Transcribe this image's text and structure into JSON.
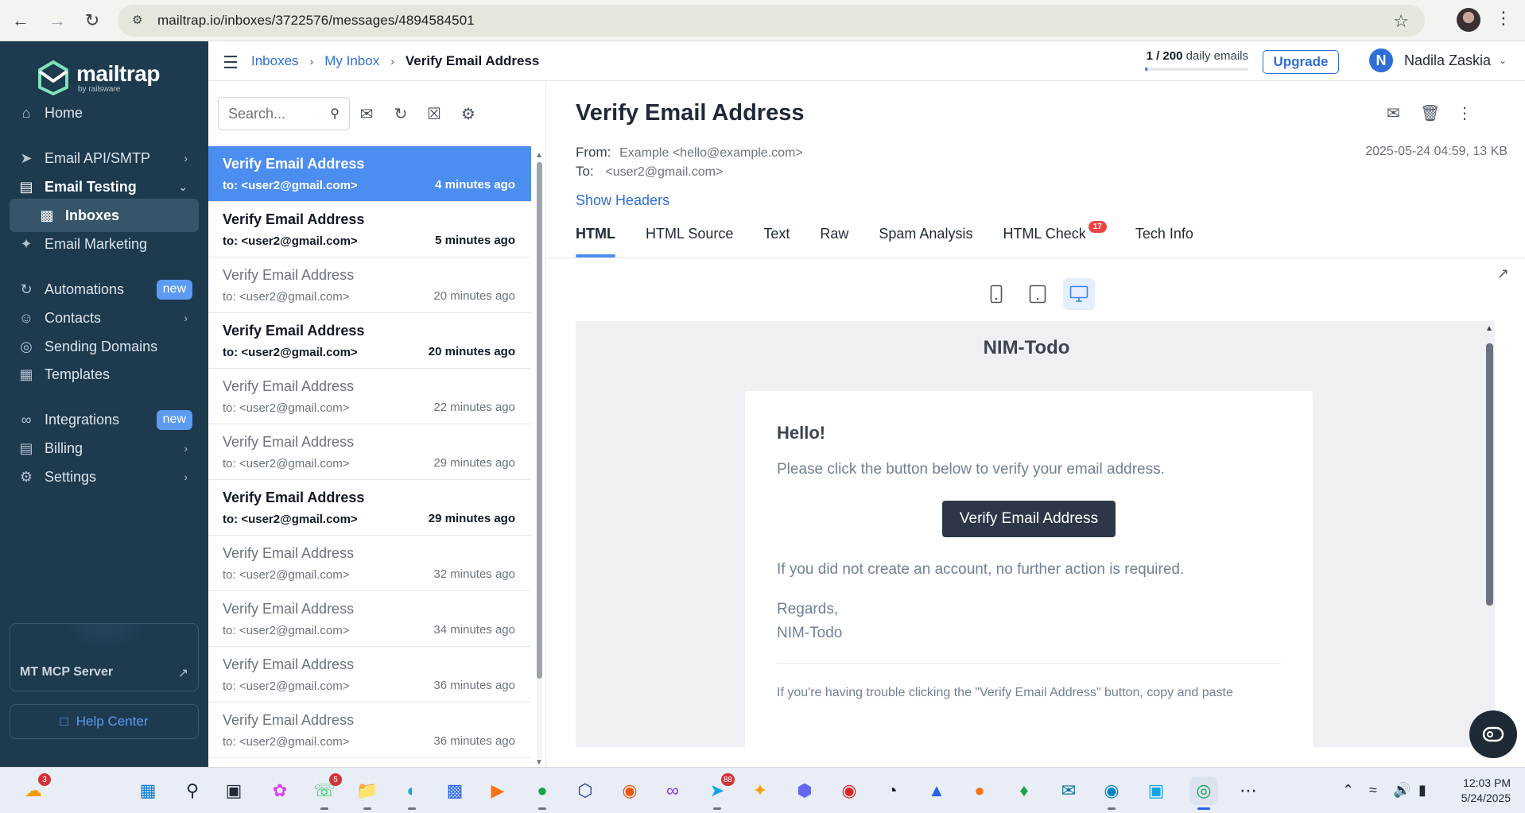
{
  "browser": {
    "url": "mailtrap.io/inboxes/3722576/messages/4894584501"
  },
  "sidebar": {
    "logo_text": "mailtrap",
    "logo_sub": "by railsware",
    "items": [
      {
        "label": "Home",
        "icon": "home-icon"
      },
      {
        "label": "Email API/SMTP",
        "icon": "send-icon"
      },
      {
        "label": "Email Testing",
        "icon": "inbox-icon"
      },
      {
        "label": "Inboxes",
        "icon": "inbox-icon"
      },
      {
        "label": "Email Marketing",
        "icon": "sparkle-icon"
      },
      {
        "label": "Automations",
        "icon": "automation-icon",
        "badge": "new"
      },
      {
        "label": "Contacts",
        "icon": "contacts-icon"
      },
      {
        "label": "Sending Domains",
        "icon": "globe-icon"
      },
      {
        "label": "Templates",
        "icon": "template-icon"
      },
      {
        "label": "Integrations",
        "icon": "link-icon",
        "badge": "new"
      },
      {
        "label": "Billing",
        "icon": "billing-icon"
      },
      {
        "label": "Settings",
        "icon": "gear-icon"
      }
    ],
    "mcp_label": "MT MCP Server",
    "help_label": "Help Center"
  },
  "topbar": {
    "breadcrumbs": [
      "Inboxes",
      "My Inbox",
      "Verify Email Address"
    ],
    "quota_used": "1",
    "quota_total": "/ 200",
    "quota_suffix": "daily emails",
    "quota_fraction": 0.005,
    "upgrade": "Upgrade",
    "user_initial": "N",
    "user_name": "Nadila Zaskia"
  },
  "list": {
    "search_placeholder": "Search...",
    "messages": [
      {
        "subject": "Verify Email Address",
        "to": "to: <user2@gmail.com>",
        "time": "4 minutes ago",
        "state": "selected"
      },
      {
        "subject": "Verify Email Address",
        "to": "to: <user2@gmail.com>",
        "time": "5 minutes ago",
        "state": "unread"
      },
      {
        "subject": "Verify Email Address",
        "to": "to: <user2@gmail.com>",
        "time": "20 minutes ago",
        "state": "read"
      },
      {
        "subject": "Verify Email Address",
        "to": "to: <user2@gmail.com>",
        "time": "20 minutes ago",
        "state": "unread"
      },
      {
        "subject": "Verify Email Address",
        "to": "to: <user2@gmail.com>",
        "time": "22 minutes ago",
        "state": "read"
      },
      {
        "subject": "Verify Email Address",
        "to": "to: <user2@gmail.com>",
        "time": "29 minutes ago",
        "state": "read"
      },
      {
        "subject": "Verify Email Address",
        "to": "to: <user2@gmail.com>",
        "time": "29 minutes ago",
        "state": "unread"
      },
      {
        "subject": "Verify Email Address",
        "to": "to: <user2@gmail.com>",
        "time": "32 minutes ago",
        "state": "read"
      },
      {
        "subject": "Verify Email Address",
        "to": "to: <user2@gmail.com>",
        "time": "34 minutes ago",
        "state": "read"
      },
      {
        "subject": "Verify Email Address",
        "to": "to: <user2@gmail.com>",
        "time": "36 minutes ago",
        "state": "read"
      },
      {
        "subject": "Verify Email Address",
        "to": "to: <user2@gmail.com>",
        "time": "36 minutes ago",
        "state": "read"
      }
    ]
  },
  "detail": {
    "title": "Verify Email Address",
    "from_label": "From:",
    "from_value": "Example <hello@example.com>",
    "to_label": "To:",
    "to_value": "<user2@gmail.com>",
    "date_size": "2025-05-24 04:59, 13 KB",
    "show_headers": "Show Headers",
    "tabs": [
      "HTML",
      "HTML Source",
      "Text",
      "Raw",
      "Spam Analysis",
      "HTML Check",
      "Tech Info"
    ],
    "html_check_count": "17"
  },
  "email": {
    "brand": "NIM-Todo",
    "hello": "Hello!",
    "line1": "Please click the button below to verify your email address.",
    "button": "Verify Email Address",
    "line2": "If you did not create an account, no further action is required.",
    "regards": "Regards,",
    "signature": "NIM-Todo",
    "footer": "If you're having trouble clicking the \"Verify Email Address\" button, copy and paste"
  },
  "taskbar": {
    "badges": {
      "weather": "3",
      "whatsapp": "5",
      "telegram": "88"
    },
    "time": "12:03 PM",
    "date": "5/24/2025"
  },
  "colors": {
    "sidebar_bg": "#1d3a4f",
    "accent": "#2f6fd6",
    "selected_row": "#4c8df0",
    "button_dark": "#2d3748"
  }
}
